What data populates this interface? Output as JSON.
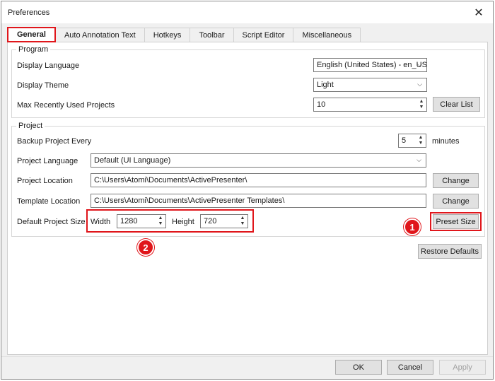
{
  "window": {
    "title": "Preferences"
  },
  "tabs": [
    {
      "label": "General",
      "active": true
    },
    {
      "label": "Auto Annotation Text"
    },
    {
      "label": "Hotkeys"
    },
    {
      "label": "Toolbar"
    },
    {
      "label": "Script Editor"
    },
    {
      "label": "Miscellaneous"
    }
  ],
  "program": {
    "legend": "Program",
    "display_language": {
      "label": "Display Language",
      "value": "English (United States) - en_US"
    },
    "display_theme": {
      "label": "Display Theme",
      "value": "Light"
    },
    "max_recent": {
      "label": "Max Recently Used Projects",
      "value": "10",
      "clear_button": "Clear List"
    }
  },
  "project": {
    "legend": "Project",
    "backup": {
      "label": "Backup Project Every",
      "value": "5",
      "unit": "minutes"
    },
    "language": {
      "label": "Project Language",
      "value": "Default (UI Language)"
    },
    "location": {
      "label": "Project Location",
      "value": "C:\\Users\\Atomi\\Documents\\ActivePresenter\\",
      "button": "Change"
    },
    "template": {
      "label": "Template Location",
      "value": "C:\\Users\\Atomi\\Documents\\ActivePresenter Templates\\",
      "button": "Change"
    },
    "size": {
      "label": "Default Project Size",
      "width_label": "Width",
      "width_value": "1280",
      "height_label": "Height",
      "height_value": "720",
      "preset_button": "Preset Size"
    }
  },
  "restore_defaults": "Restore Defaults",
  "footer": {
    "ok": "OK",
    "cancel": "Cancel",
    "apply": "Apply"
  },
  "callouts": {
    "one": "1",
    "two": "2"
  },
  "icons": {
    "close": "close-icon",
    "dropdown": "chevron-down-icon",
    "spinner": "spin-arrows-icon"
  },
  "colors": {
    "highlight": "#e0161b"
  }
}
